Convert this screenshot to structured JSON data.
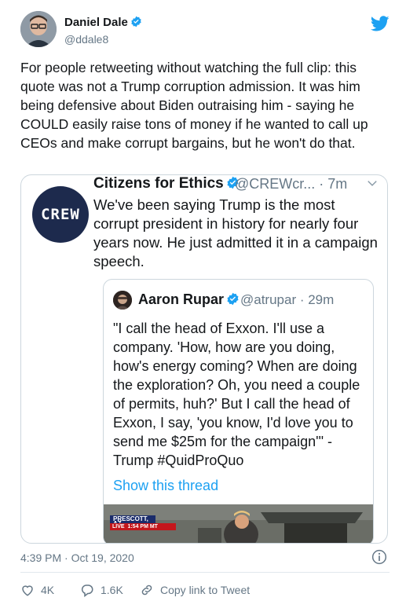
{
  "author": {
    "name": "Daniel Dale",
    "handle": "@ddale8",
    "verified": true
  },
  "tweet": {
    "text": "For people retweeting without watching the full clip: this quote was not a Trump corruption admission. It was him being defensive about Biden outraising him - saying he COULD easily raise tons of money if he wanted to call up CEOs and make corrupt bargains, but he won't do that."
  },
  "quoted_tweet": {
    "avatar_text": "CREW",
    "name": "Citizens for Ethics",
    "meta": "@CREWcr... · 7m",
    "text": "We've been saying Trump is the most corrupt president in history for nearly four years now. He just admitted it in a campaign speech.",
    "nested_quote": {
      "name": "Aaron Rupar",
      "meta": "@atrupar · 29m",
      "text": "\"I call the head of Exxon. I'll use a company. 'How, how are you doing, how's energy coming? When are doing the exploration? Oh, you need a couple of permits, huh?' But I call the head of Exxon, I say, 'you know, I'd love you to send me $25m for the campaign'\" - Trump #QuidProQuo",
      "show_thread_label": "Show this thread",
      "video_overlay": {
        "location": "PRESCOTT, AZ",
        "live_label": "LIVE",
        "time": "1:54 PM MT"
      }
    }
  },
  "timestamp": "4:39 PM · Oct 19, 2020",
  "actions": {
    "likes": "4K",
    "replies": "1.6K",
    "copy_link_label": "Copy link to Tweet"
  },
  "colors": {
    "accent": "#1da1f2",
    "muted": "#657786",
    "border": "#ccd6dd",
    "crew_navy": "#1d2a4d"
  }
}
